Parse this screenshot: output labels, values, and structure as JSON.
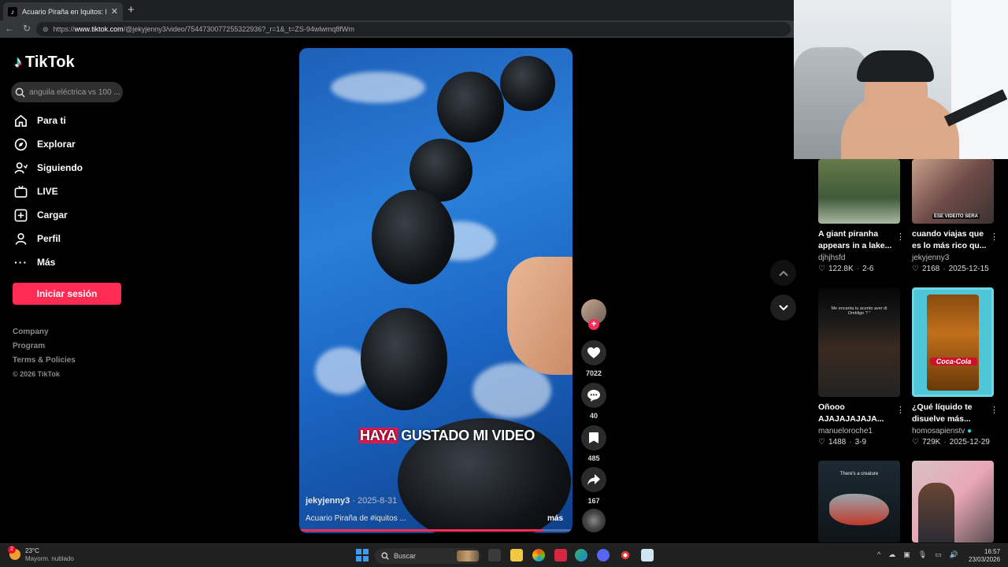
{
  "browser": {
    "tab_title": "Acuario Piraña en Iquitos: Explora",
    "tab_favicon": "tiktok-favicon",
    "url_scheme": "https://",
    "url_host": "www.tiktok.com",
    "url_path": "/@jekyjenny3/video/7544730077255322936?_r=1&_t=ZS-94wlwmq8fWm"
  },
  "sidebar": {
    "logo_text": "TikTok",
    "search_placeholder": "anguila eléctrica vs 100 ...",
    "nav": [
      {
        "label": "Para ti",
        "icon": "home-icon"
      },
      {
        "label": "Explorar",
        "icon": "compass-icon"
      },
      {
        "label": "Siguiendo",
        "icon": "following-icon"
      },
      {
        "label": "LIVE",
        "icon": "live-tv-icon"
      },
      {
        "label": "Cargar",
        "icon": "upload-icon"
      },
      {
        "label": "Perfil",
        "icon": "profile-icon"
      },
      {
        "label": "Más",
        "icon": "more-dots-icon"
      }
    ],
    "login_label": "Iniciar sesión",
    "footer": [
      "Company",
      "Program",
      "Terms & Policies",
      "© 2026 TikTok"
    ]
  },
  "video": {
    "caption_highlight": "HAYA",
    "caption_rest": " GUSTADO MI VIDEO",
    "author": "jekyjenny3",
    "date": " · 2025-8-31",
    "description": "Acuario Piraña de #iquitos ...",
    "more_label": "más",
    "progress": 0.89
  },
  "actions": {
    "likes": "7022",
    "comments": "40",
    "saves": "485",
    "shares": "167"
  },
  "feed": [
    {
      "title": "A giant piranha appears in a lake...",
      "author": "djhjhsfd",
      "likes": "122.8K",
      "date": "2-6",
      "thumb_text": "",
      "verified": false
    },
    {
      "title": "cuando viajas que es lo más rico qu...",
      "author": "jekyjenny3",
      "likes": "2168",
      "date": "2025-12-15",
      "thumb_text": "ESE VIDEITO SERA",
      "verified": false
    },
    {
      "title": "Oñooo AJAJAJAJAJA...",
      "author": "manueloroche1",
      "likes": "1488",
      "date": "3-9",
      "thumb_text": "Me encanta tu acento aver di Ombligo ? \"",
      "verified": false
    },
    {
      "title": "¿Qué líquido te disuelve más...",
      "author": "homosapienstv",
      "likes": "729K",
      "date": "2025-12-29",
      "thumb_text": "Coca-Cola",
      "verified": true
    },
    {
      "title": "",
      "author": "",
      "likes": "",
      "date": "",
      "thumb_text": "There's a creature",
      "verified": false
    },
    {
      "title": "",
      "author": "",
      "likes": "",
      "date": "",
      "thumb_text": "",
      "verified": false
    }
  ],
  "taskbar": {
    "temperature": "23°C",
    "weather": "Mayorm. nublado",
    "weather_badge": "2",
    "search_label": "Buscar",
    "time": "16:57",
    "date": "23/03/2026"
  },
  "colors": {
    "brand": "#fe2c55",
    "background": "#000000",
    "caption_highlight": "#e6184f"
  }
}
